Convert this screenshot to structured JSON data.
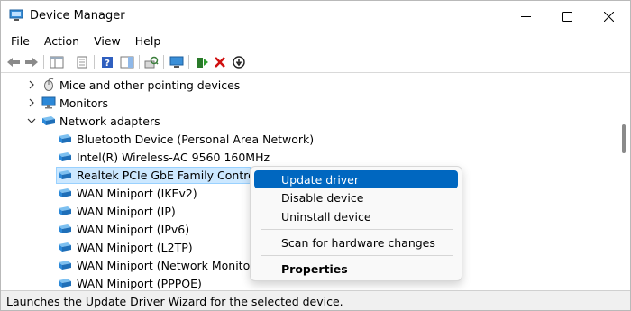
{
  "window": {
    "title": "Device Manager"
  },
  "menubar": {
    "items": [
      "File",
      "Action",
      "View",
      "Help"
    ]
  },
  "toolbar": {
    "buttons": [
      "back-arrow-icon",
      "forward-arrow-icon",
      "show-hide-console-tree-icon",
      "properties-icon",
      "help-icon",
      "action-pane-icon",
      "scan-hardware-icon",
      "update-driver-icon",
      "uninstall-device-icon",
      "disable-device-icon"
    ]
  },
  "tree": {
    "categories": [
      {
        "label": "Mice and other pointing devices",
        "expanded": false
      },
      {
        "label": "Monitors",
        "expanded": false
      },
      {
        "label": "Network adapters",
        "expanded": true
      }
    ],
    "network_adapters": [
      "Bluetooth Device (Personal Area Network)",
      "Intel(R) Wireless-AC 9560 160MHz",
      "Realtek PCIe GbE Family Controller",
      "WAN Miniport (IKEv2)",
      "WAN Miniport (IP)",
      "WAN Miniport (IPv6)",
      "WAN Miniport (L2TP)",
      "WAN Miniport (Network Monitor)",
      "WAN Miniport (PPPOE)"
    ],
    "selected": "Realtek PCIe GbE Family Controller"
  },
  "context_menu": {
    "update_driver": "Update driver",
    "disable_device": "Disable device",
    "uninstall_device": "Uninstall device",
    "scan_hardware": "Scan for hardware changes",
    "properties": "Properties"
  },
  "statusbar": {
    "text": "Launches the Update Driver Wizard for the selected device."
  },
  "colors": {
    "highlight": "#0067c0",
    "selection": "#cce8ff",
    "device_icon": "#2b88d8"
  }
}
